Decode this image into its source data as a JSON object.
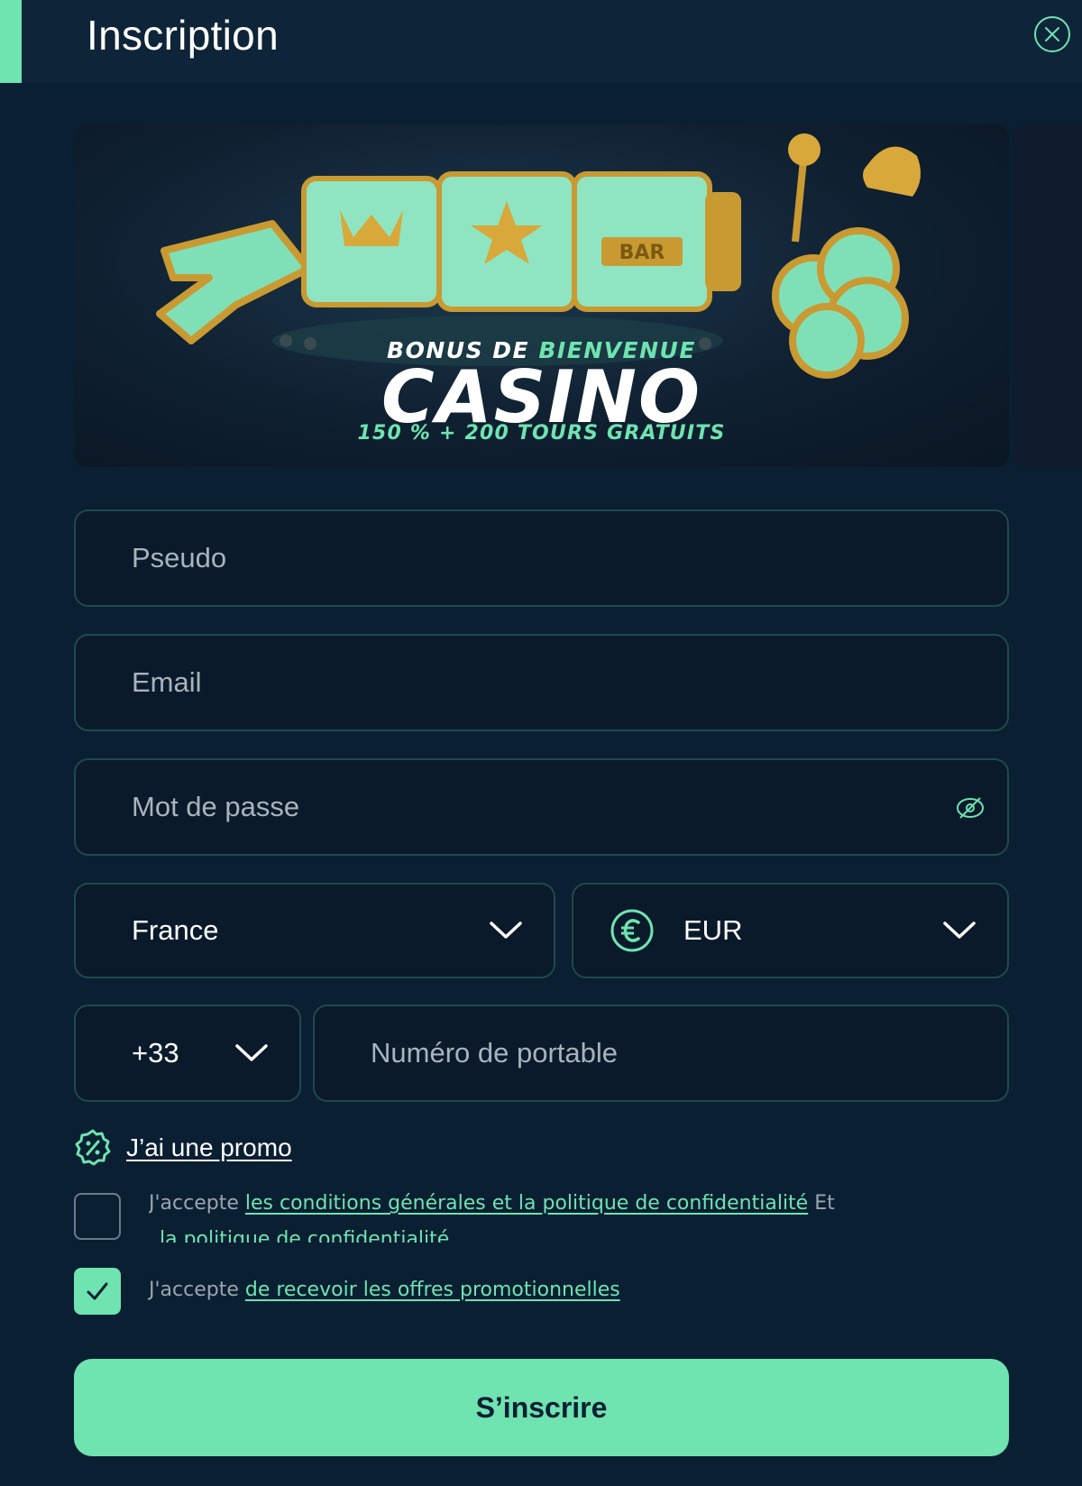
{
  "header": {
    "title": "Inscription"
  },
  "banner": {
    "line1_a": "BONUS DE",
    "line1_b": "BIENVENUE",
    "line2": "CASINO",
    "line3": "150 % + 200 TOURS GRATUITS",
    "reel_symbol": "BAR"
  },
  "form": {
    "username_placeholder": "Pseudo",
    "email_placeholder": "Email",
    "password_placeholder": "Mot de passe",
    "country_value": "France",
    "currency_value": "EUR",
    "dial_code_value": "+33",
    "phone_placeholder": "Numéro de portable",
    "promo_label": "J’ai une promo",
    "terms": {
      "prefix": "J'accepte",
      "link": "les conditions générales et la politique de confidentialité",
      "suffix": "Et",
      "link2": "la politique de confidentialité",
      "checked": false
    },
    "offers": {
      "prefix": "J'accepte",
      "link": "de recevoir les offres promotionnelles",
      "checked": true
    },
    "submit_label": "S’inscrire"
  },
  "colors": {
    "background": "#0b1f33",
    "accent": "#6fe3b0",
    "field_border": "#1e4a4a"
  },
  "icons": [
    "close-icon",
    "eye-off-icon",
    "chevron-down-icon",
    "euro-icon",
    "promo-badge-icon",
    "check-icon"
  ]
}
